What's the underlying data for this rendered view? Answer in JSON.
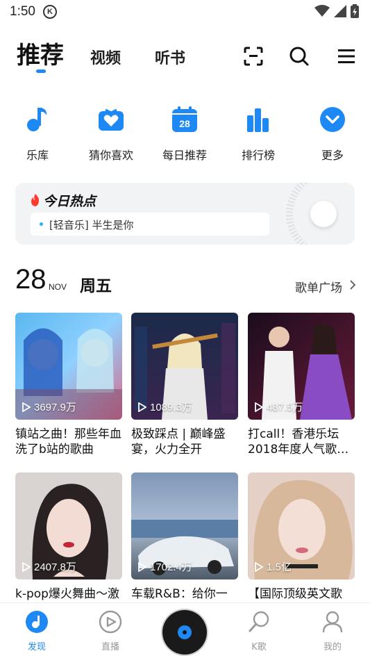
{
  "status_bar": {
    "time": "1:50",
    "badge": "K"
  },
  "header": {
    "tabs": [
      {
        "label": "推荐"
      },
      {
        "label": "视频"
      },
      {
        "label": "听书"
      }
    ],
    "accent": "#1e88f5"
  },
  "quick_nav": [
    {
      "label": "乐库",
      "icon": "music-note-icon"
    },
    {
      "label": "猜你喜欢",
      "icon": "heart-radio-icon"
    },
    {
      "label": "每日推荐",
      "icon": "calendar-icon",
      "day": "28"
    },
    {
      "label": "排行榜",
      "icon": "chart-bars-icon"
    },
    {
      "label": "更多",
      "icon": "chevron-down-icon"
    }
  ],
  "hot_today": {
    "title": "今日热点",
    "item": "[轻音乐] 半生是你"
  },
  "date_row": {
    "day": "28",
    "month": "NOV",
    "weekday": "周五",
    "link": "歌单广场"
  },
  "playlists": [
    {
      "plays": "3697.9万",
      "title": "镇站之曲！那些年血洗了b站的歌曲"
    },
    {
      "plays": "1089.3万",
      "title": "极致踩点 | 巅峰盛宴，火力全开"
    },
    {
      "plays": "487.5万",
      "title": "打call！香港乐坛2018年度人气歌…"
    },
    {
      "plays": "2407.8万",
      "title": "k-pop爆火舞曲～激"
    },
    {
      "plays": "1702.4万",
      "title": "车载R&B：给你一"
    },
    {
      "plays": "1.5亿",
      "title": "【国际顶级英文歌"
    }
  ],
  "bottom_nav": [
    {
      "label": "发现",
      "active": true
    },
    {
      "label": "直播",
      "active": false
    },
    {
      "label": "K歌",
      "active": false
    },
    {
      "label": "我的",
      "active": false
    }
  ]
}
